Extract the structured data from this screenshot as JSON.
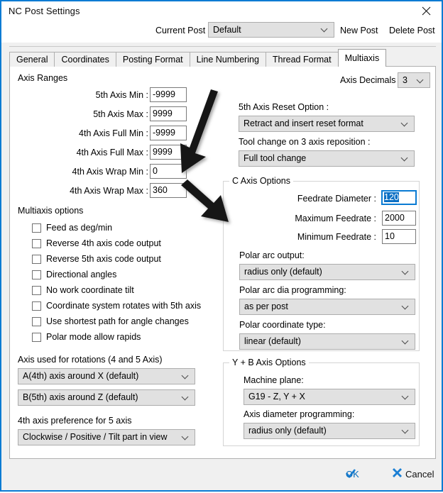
{
  "window": {
    "title": "NC Post Settings",
    "close_icon": "close-icon",
    "border_color": "#0a7bd3"
  },
  "postbar": {
    "current_post_label": "Current Post -",
    "current_post_value": "Default",
    "new_post_label": "New Post",
    "delete_post_label": "Delete Post"
  },
  "tabs": [
    {
      "label": "General",
      "active": false
    },
    {
      "label": "Coordinates",
      "active": false
    },
    {
      "label": "Posting Format",
      "active": false
    },
    {
      "label": "Line Numbering",
      "active": false
    },
    {
      "label": "Thread Format",
      "active": false
    },
    {
      "label": "Multiaxis",
      "active": true
    }
  ],
  "axis_ranges": {
    "section_title": "Axis Ranges",
    "fields": [
      {
        "label": "5th Axis Min :",
        "value": "-9999"
      },
      {
        "label": "5th Axis Max :",
        "value": "9999"
      },
      {
        "label": "4th Axis Full Min :",
        "value": "-9999"
      },
      {
        "label": "4th Axis Full Max :",
        "value": "9999"
      },
      {
        "label": "4th Axis Wrap Min :",
        "value": "0"
      },
      {
        "label": "4th Axis Wrap Max :",
        "value": "360"
      }
    ]
  },
  "axis_decimals": {
    "label": "Axis Decimals :",
    "value": "3"
  },
  "reset_option": {
    "label": "5th Axis Reset Option :",
    "value": "Retract and insert reset format"
  },
  "tool_change": {
    "label": "Tool change on 3 axis reposition :",
    "value": "Full tool change"
  },
  "multiaxis_options": {
    "section_title": "Multiaxis options",
    "checkboxes": [
      {
        "label": "Feed as deg/min",
        "checked": false
      },
      {
        "label": "Reverse 4th axis code output",
        "checked": false
      },
      {
        "label": "Reverse 5th axis code output",
        "checked": false
      },
      {
        "label": "Directional angles",
        "checked": false
      },
      {
        "label": "No work coordinate tilt",
        "checked": false
      },
      {
        "label": "Coordinate system rotates with 5th axis",
        "checked": false
      },
      {
        "label": "Use shortest path for angle changes",
        "checked": false
      },
      {
        "label": "Polar mode allow rapids",
        "checked": false
      }
    ]
  },
  "rotations": {
    "label": "Axis used for rotations (4 and 5 Axis)",
    "axis4_value": "A(4th) axis around X (default)",
    "axis5_value": "B(5th) axis around Z (default)"
  },
  "preference": {
    "label": "4th axis preference for 5 axis",
    "value": "Clockwise / Positive / Tilt part in view"
  },
  "c_axis_options": {
    "group_title": "C Axis Options",
    "feedrate_diameter_label": "Feedrate Diameter :",
    "feedrate_diameter_value": "120",
    "maximum_feedrate_label": "Maximum Feedrate :",
    "maximum_feedrate_value": "2000",
    "minimum_feedrate_label": "Minimum Feedrate :",
    "minimum_feedrate_value": "10",
    "polar_arc_output_label": "Polar arc output:",
    "polar_arc_output_value": "radius only (default)",
    "polar_arc_dia_label": "Polar arc dia programming:",
    "polar_arc_dia_value": "as per post",
    "polar_coord_type_label": "Polar coordinate type:",
    "polar_coord_type_value": "linear (default)"
  },
  "yb_axis_options": {
    "group_title": "Y + B Axis Options",
    "machine_plane_label": "Machine plane:",
    "machine_plane_value": "G19 - Z, Y + X",
    "axis_diameter_label": "Axis diameter programming:",
    "axis_diameter_value": "radius only (default)"
  },
  "footer": {
    "ok_label": "OK",
    "cancel_label": "Cancel",
    "ok_icon": "checkmark-icon",
    "cancel_icon": "x-mark-icon",
    "accent_color": "#0a6ebd"
  },
  "annotations": {
    "arrow_1": "arrow pointing to 4th Axis Wrap Min field",
    "arrow_2": "arrow pointing to 4th Axis Wrap Max field"
  }
}
